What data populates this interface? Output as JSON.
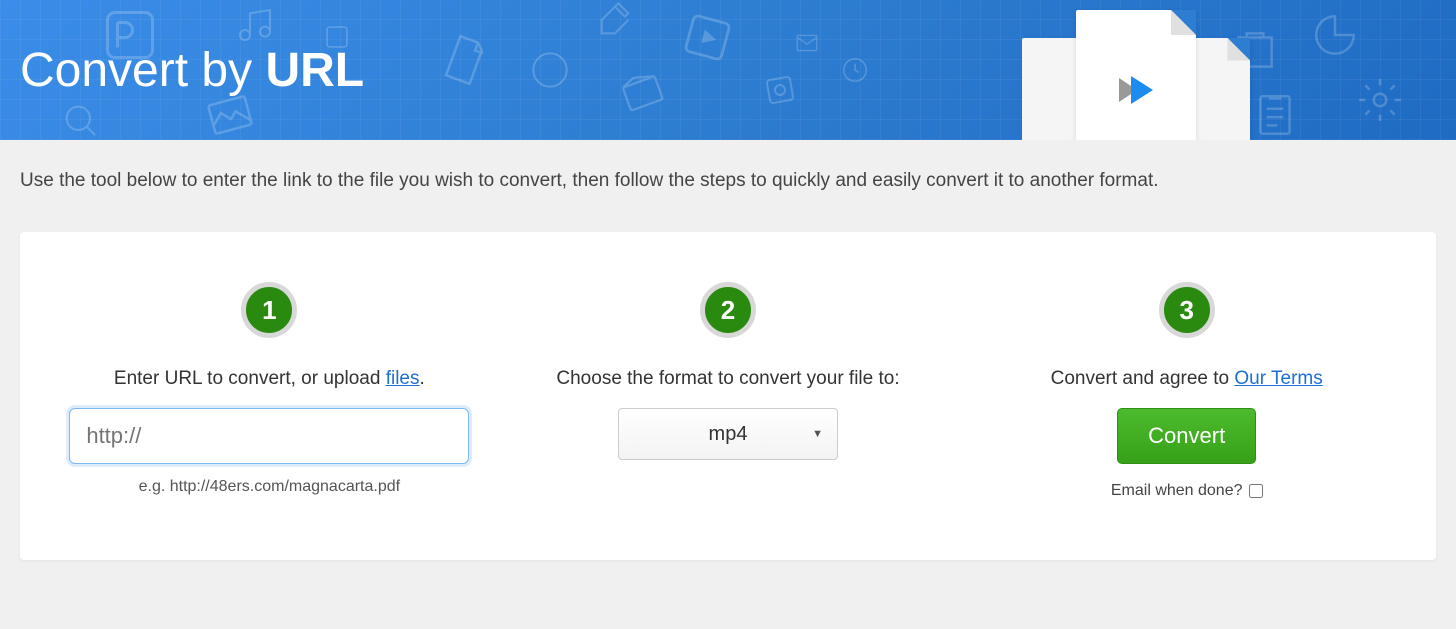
{
  "hero": {
    "title_prefix": "Convert by ",
    "title_bold": "URL"
  },
  "intro": "Use the tool below to enter the link to the file you wish to convert, then follow the steps to quickly and easily convert it to another format.",
  "steps": {
    "one": {
      "number": "1",
      "label_pre": "Enter URL to convert, or upload ",
      "label_link": "files",
      "label_post": ".",
      "placeholder": "http://",
      "example": "e.g. http://48ers.com/magnacarta.pdf"
    },
    "two": {
      "number": "2",
      "label": "Choose the format to convert your file to:",
      "selected_format": "mp4"
    },
    "three": {
      "number": "3",
      "label_pre": "Convert and agree to ",
      "label_link": "Our Terms",
      "button": "Convert",
      "email_label": "Email when done?",
      "email_checked": false
    }
  }
}
